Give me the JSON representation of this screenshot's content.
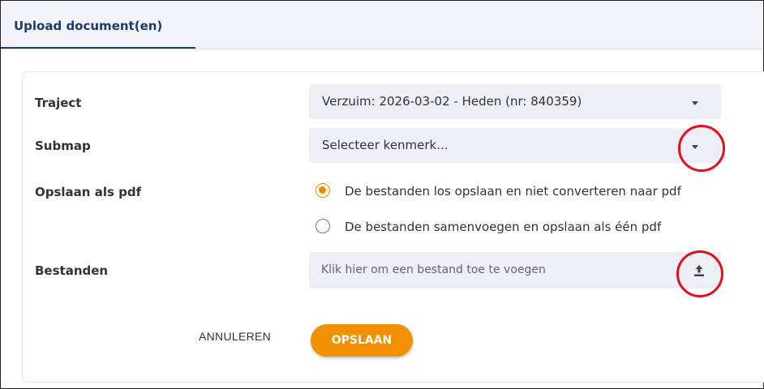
{
  "tabs": [
    {
      "label": "Upload document(en)",
      "active": true
    }
  ],
  "form": {
    "traject": {
      "label": "Traject",
      "value": "Verzuim: 2026-03-02 - Heden (nr: 840359)"
    },
    "submap": {
      "label": "Submap",
      "value": "Selecteer kenmerk..."
    },
    "pdf": {
      "label": "Opslaan als pdf",
      "options": [
        {
          "label": "De bestanden los opslaan en niet converteren naar pdf",
          "selected": true
        },
        {
          "label": "De bestanden samenvoegen en opslaan als één pdf",
          "selected": false
        }
      ]
    },
    "files": {
      "label": "Bestanden",
      "placeholder": "Klik hier om een bestand toe te voegen",
      "icon": "upload-icon"
    }
  },
  "actions": {
    "cancel_label": "ANNULEREN",
    "save_label": "OPSLAAN"
  },
  "colors": {
    "accent": "#f29100",
    "annotation": "#e3101a",
    "tab_text": "#1f3a6a",
    "field_bg": "#eeeef6"
  }
}
